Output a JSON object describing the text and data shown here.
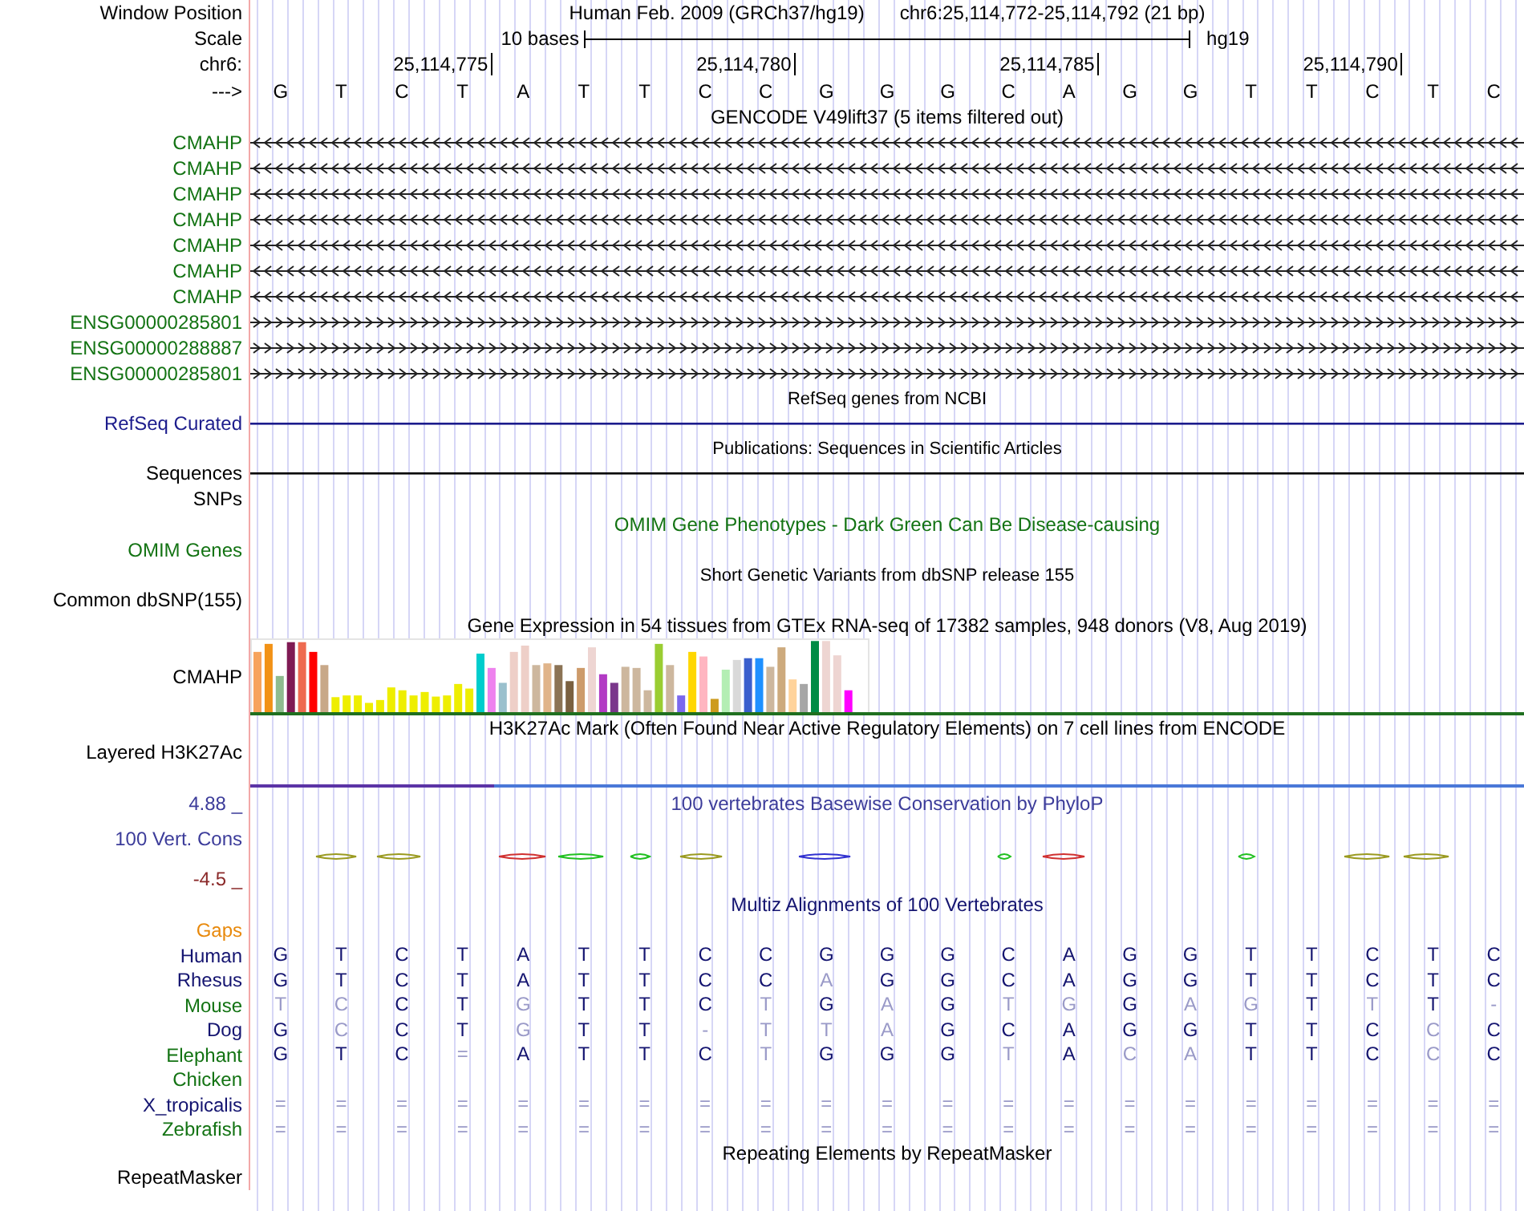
{
  "rows": [
    {
      "kind": "position",
      "label": "Window Position",
      "assembly": "Human Feb. 2009 (GRCh37/hg19)",
      "range": "chr6:25,114,772-25,114,792 (21 bp)"
    },
    {
      "kind": "scale",
      "label": "Scale",
      "span_label": "10 bases",
      "assembly_label": "hg19"
    },
    {
      "kind": "ruler",
      "label": "chr6:",
      "ticks": [
        "25,114,775",
        "25,114,780",
        "25,114,785",
        "25,114,790"
      ]
    },
    {
      "kind": "bases",
      "label": "--->",
      "bases": [
        "G",
        "T",
        "C",
        "T",
        "A",
        "T",
        "T",
        "C",
        "C",
        "G",
        "G",
        "G",
        "C",
        "A",
        "G",
        "G",
        "T",
        "T",
        "C",
        "T",
        "C"
      ]
    },
    {
      "kind": "title",
      "text": "GENCODE V49lift37 (5 items filtered out)",
      "color": "#000000"
    },
    {
      "kind": "gene",
      "label": "CMAHP",
      "reverse": true,
      "color": "#137313"
    },
    {
      "kind": "gene",
      "label": "CMAHP",
      "reverse": true,
      "color": "#137313"
    },
    {
      "kind": "gene",
      "label": "CMAHP",
      "reverse": true,
      "color": "#137313"
    },
    {
      "kind": "gene",
      "label": "CMAHP",
      "reverse": true,
      "color": "#137313"
    },
    {
      "kind": "gene",
      "label": "CMAHP",
      "reverse": true,
      "color": "#137313"
    },
    {
      "kind": "gene",
      "label": "CMAHP",
      "reverse": true,
      "color": "#137313"
    },
    {
      "kind": "gene",
      "label": "CMAHP",
      "reverse": true,
      "color": "#137313"
    },
    {
      "kind": "gene",
      "label": "ENSG00000285801",
      "reverse": false,
      "color": "#137313"
    },
    {
      "kind": "gene",
      "label": "ENSG00000288887",
      "reverse": false,
      "color": "#137313"
    },
    {
      "kind": "gene",
      "label": "ENSG00000285801",
      "reverse": false,
      "color": "#137313"
    },
    {
      "kind": "caption",
      "text": "RefSeq genes from NCBI"
    },
    {
      "kind": "line",
      "label": "RefSeq Curated",
      "color": "#1c1c8c"
    },
    {
      "kind": "caption",
      "text": "Publications: Sequences in Scientific Articles"
    },
    {
      "kind": "line",
      "label": "Sequences",
      "color": "#000000"
    },
    {
      "kind": "empty",
      "label": "SNPs",
      "color": "#000000"
    },
    {
      "kind": "title",
      "text": "OMIM Gene Phenotypes - Dark Green Can Be Disease-causing",
      "color": "#137313"
    },
    {
      "kind": "empty",
      "label": "OMIM Genes",
      "color": "#137313"
    },
    {
      "kind": "caption",
      "text": "Short Genetic Variants from dbSNP release 155"
    },
    {
      "kind": "empty",
      "label": "Common dbSNP(155)",
      "color": "#000000"
    },
    {
      "kind": "title",
      "text": "Gene Expression in 54 tissues from GTEx RNA-seq of 17382 samples, 948 donors (V8, Aug 2019)",
      "color": "#000000"
    },
    {
      "kind": "expression",
      "label": "CMAHP"
    },
    {
      "kind": "title",
      "text": "H3K27Ac Mark (Often Found Near Active Regulatory Elements) on 7 cell lines from ENCODE",
      "color": "#000000"
    },
    {
      "kind": "signal",
      "label": "Layered H3K27Ac"
    },
    {
      "kind": "axis-title",
      "label": "4.88 _",
      "text": "100 vertebrates Basewise Conservation by PhyloP",
      "color": "#3c3c9a"
    },
    {
      "kind": "wiggle",
      "label": "100 Vert. Cons",
      "color": "#3c3c9a"
    },
    {
      "kind": "empty",
      "label": "-4.5 _",
      "color": "#8b2a2a"
    },
    {
      "kind": "title",
      "text": "Multiz Alignments of 100 Vertebrates",
      "color": "#141470"
    },
    {
      "kind": "empty",
      "label": "Gaps",
      "color": "#e8890c"
    },
    {
      "kind": "species",
      "label": "Human",
      "color": "#141470",
      "bases": [
        {
          "base": "G",
          "faded": false
        },
        {
          "base": "T",
          "faded": false
        },
        {
          "base": "C",
          "faded": false
        },
        {
          "base": "T",
          "faded": false
        },
        {
          "base": "A",
          "faded": false
        },
        {
          "base": "T",
          "faded": false
        },
        {
          "base": "T",
          "faded": false
        },
        {
          "base": "C",
          "faded": false
        },
        {
          "base": "C",
          "faded": false
        },
        {
          "base": "G",
          "faded": false
        },
        {
          "base": "G",
          "faded": false
        },
        {
          "base": "G",
          "faded": false
        },
        {
          "base": "C",
          "faded": false
        },
        {
          "base": "A",
          "faded": false
        },
        {
          "base": "G",
          "faded": false
        },
        {
          "base": "G",
          "faded": false
        },
        {
          "base": "T",
          "faded": false
        },
        {
          "base": "T",
          "faded": false
        },
        {
          "base": "C",
          "faded": false
        },
        {
          "base": "T",
          "faded": false
        },
        {
          "base": "C",
          "faded": false
        }
      ]
    },
    {
      "kind": "species",
      "label": "Rhesus",
      "color": "#141470",
      "bases": [
        {
          "base": "G",
          "faded": false
        },
        {
          "base": "T",
          "faded": false
        },
        {
          "base": "C",
          "faded": false
        },
        {
          "base": "T",
          "faded": false
        },
        {
          "base": "A",
          "faded": false
        },
        {
          "base": "T",
          "faded": false
        },
        {
          "base": "T",
          "faded": false
        },
        {
          "base": "C",
          "faded": false
        },
        {
          "base": "C",
          "faded": false
        },
        {
          "base": "A",
          "faded": true
        },
        {
          "base": "G",
          "faded": false
        },
        {
          "base": "G",
          "faded": false
        },
        {
          "base": "C",
          "faded": false
        },
        {
          "base": "A",
          "faded": false
        },
        {
          "base": "G",
          "faded": false
        },
        {
          "base": "G",
          "faded": false
        },
        {
          "base": "T",
          "faded": false
        },
        {
          "base": "T",
          "faded": false
        },
        {
          "base": "C",
          "faded": false
        },
        {
          "base": "T",
          "faded": false
        },
        {
          "base": "C",
          "faded": false
        }
      ]
    },
    {
      "kind": "species",
      "label": "Mouse",
      "color": "#137313",
      "bases": [
        {
          "base": "T",
          "faded": true
        },
        {
          "base": "C",
          "faded": true
        },
        {
          "base": "C",
          "faded": false
        },
        {
          "base": "T",
          "faded": false
        },
        {
          "base": "G",
          "faded": true
        },
        {
          "base": "T",
          "faded": false
        },
        {
          "base": "T",
          "faded": false
        },
        {
          "base": "C",
          "faded": false
        },
        {
          "base": "T",
          "faded": true
        },
        {
          "base": "G",
          "faded": false
        },
        {
          "base": "A",
          "faded": true
        },
        {
          "base": "G",
          "faded": false
        },
        {
          "base": "T",
          "faded": true
        },
        {
          "base": "G",
          "faded": true
        },
        {
          "base": "G",
          "faded": false
        },
        {
          "base": "A",
          "faded": true
        },
        {
          "base": "G",
          "faded": true
        },
        {
          "base": "T",
          "faded": false
        },
        {
          "base": "T",
          "faded": true
        },
        {
          "base": "T",
          "faded": false
        },
        {
          "base": "-",
          "faded": true
        }
      ]
    },
    {
      "kind": "species",
      "label": "Dog",
      "color": "#141470",
      "bases": [
        {
          "base": "G",
          "faded": false
        },
        {
          "base": "C",
          "faded": true
        },
        {
          "base": "C",
          "faded": false
        },
        {
          "base": "T",
          "faded": false
        },
        {
          "base": "G",
          "faded": true
        },
        {
          "base": "T",
          "faded": false
        },
        {
          "base": "T",
          "faded": false
        },
        {
          "base": "-",
          "faded": true
        },
        {
          "base": "T",
          "faded": true
        },
        {
          "base": "T",
          "faded": true
        },
        {
          "base": "A",
          "faded": true
        },
        {
          "base": "G",
          "faded": false
        },
        {
          "base": "C",
          "faded": false
        },
        {
          "base": "A",
          "faded": false
        },
        {
          "base": "G",
          "faded": false
        },
        {
          "base": "G",
          "faded": false
        },
        {
          "base": "T",
          "faded": false
        },
        {
          "base": "T",
          "faded": false
        },
        {
          "base": "C",
          "faded": false
        },
        {
          "base": "C",
          "faded": true
        },
        {
          "base": "C",
          "faded": false
        }
      ]
    },
    {
      "kind": "species",
      "label": "Elephant",
      "color": "#137313",
      "bases": [
        {
          "base": "G",
          "faded": false
        },
        {
          "base": "T",
          "faded": false
        },
        {
          "base": "C",
          "faded": false
        },
        {
          "base": "=",
          "faded": true
        },
        {
          "base": "A",
          "faded": false
        },
        {
          "base": "T",
          "faded": false
        },
        {
          "base": "T",
          "faded": false
        },
        {
          "base": "C",
          "faded": false
        },
        {
          "base": "T",
          "faded": true
        },
        {
          "base": "G",
          "faded": false
        },
        {
          "base": "G",
          "faded": false
        },
        {
          "base": "G",
          "faded": false
        },
        {
          "base": "T",
          "faded": true
        },
        {
          "base": "A",
          "faded": false
        },
        {
          "base": "C",
          "faded": true
        },
        {
          "base": "A",
          "faded": true
        },
        {
          "base": "T",
          "faded": false
        },
        {
          "base": "T",
          "faded": false
        },
        {
          "base": "C",
          "faded": false
        },
        {
          "base": "C",
          "faded": true
        },
        {
          "base": "C",
          "faded": false
        }
      ]
    },
    {
      "kind": "species",
      "label": "Chicken",
      "color": "#137313",
      "bases": []
    },
    {
      "kind": "species",
      "label": "X_tropicalis",
      "color": "#141470",
      "bases": [
        {
          "base": "=",
          "faded": true
        },
        {
          "base": "=",
          "faded": true
        },
        {
          "base": "=",
          "faded": true
        },
        {
          "base": "=",
          "faded": true
        },
        {
          "base": "=",
          "faded": true
        },
        {
          "base": "=",
          "faded": true
        },
        {
          "base": "=",
          "faded": true
        },
        {
          "base": "=",
          "faded": true
        },
        {
          "base": "=",
          "faded": true
        },
        {
          "base": "=",
          "faded": true
        },
        {
          "base": "=",
          "faded": true
        },
        {
          "base": "=",
          "faded": true
        },
        {
          "base": "=",
          "faded": true
        },
        {
          "base": "=",
          "faded": true
        },
        {
          "base": "=",
          "faded": true
        },
        {
          "base": "=",
          "faded": true
        },
        {
          "base": "=",
          "faded": true
        },
        {
          "base": "=",
          "faded": true
        },
        {
          "base": "=",
          "faded": true
        },
        {
          "base": "=",
          "faded": true
        },
        {
          "base": "=",
          "faded": true
        }
      ]
    },
    {
      "kind": "species",
      "label": "Zebrafish",
      "color": "#137313",
      "bases": [
        {
          "base": "=",
          "faded": true
        },
        {
          "base": "=",
          "faded": true
        },
        {
          "base": "=",
          "faded": true
        },
        {
          "base": "=",
          "faded": true
        },
        {
          "base": "=",
          "faded": true
        },
        {
          "base": "=",
          "faded": true
        },
        {
          "base": "=",
          "faded": true
        },
        {
          "base": "=",
          "faded": true
        },
        {
          "base": "=",
          "faded": true
        },
        {
          "base": "=",
          "faded": true
        },
        {
          "base": "=",
          "faded": true
        },
        {
          "base": "=",
          "faded": true
        },
        {
          "base": "=",
          "faded": true
        },
        {
          "base": "=",
          "faded": true
        },
        {
          "base": "=",
          "faded": true
        },
        {
          "base": "=",
          "faded": true
        },
        {
          "base": "=",
          "faded": true
        },
        {
          "base": "=",
          "faded": true
        },
        {
          "base": "=",
          "faded": true
        },
        {
          "base": "=",
          "faded": true
        },
        {
          "base": "=",
          "faded": true
        }
      ]
    },
    {
      "kind": "title",
      "text": "Repeating Elements by RepeatMasker",
      "color": "#000000"
    },
    {
      "kind": "empty",
      "label": "RepeatMasker",
      "color": "#000000"
    }
  ]
}
